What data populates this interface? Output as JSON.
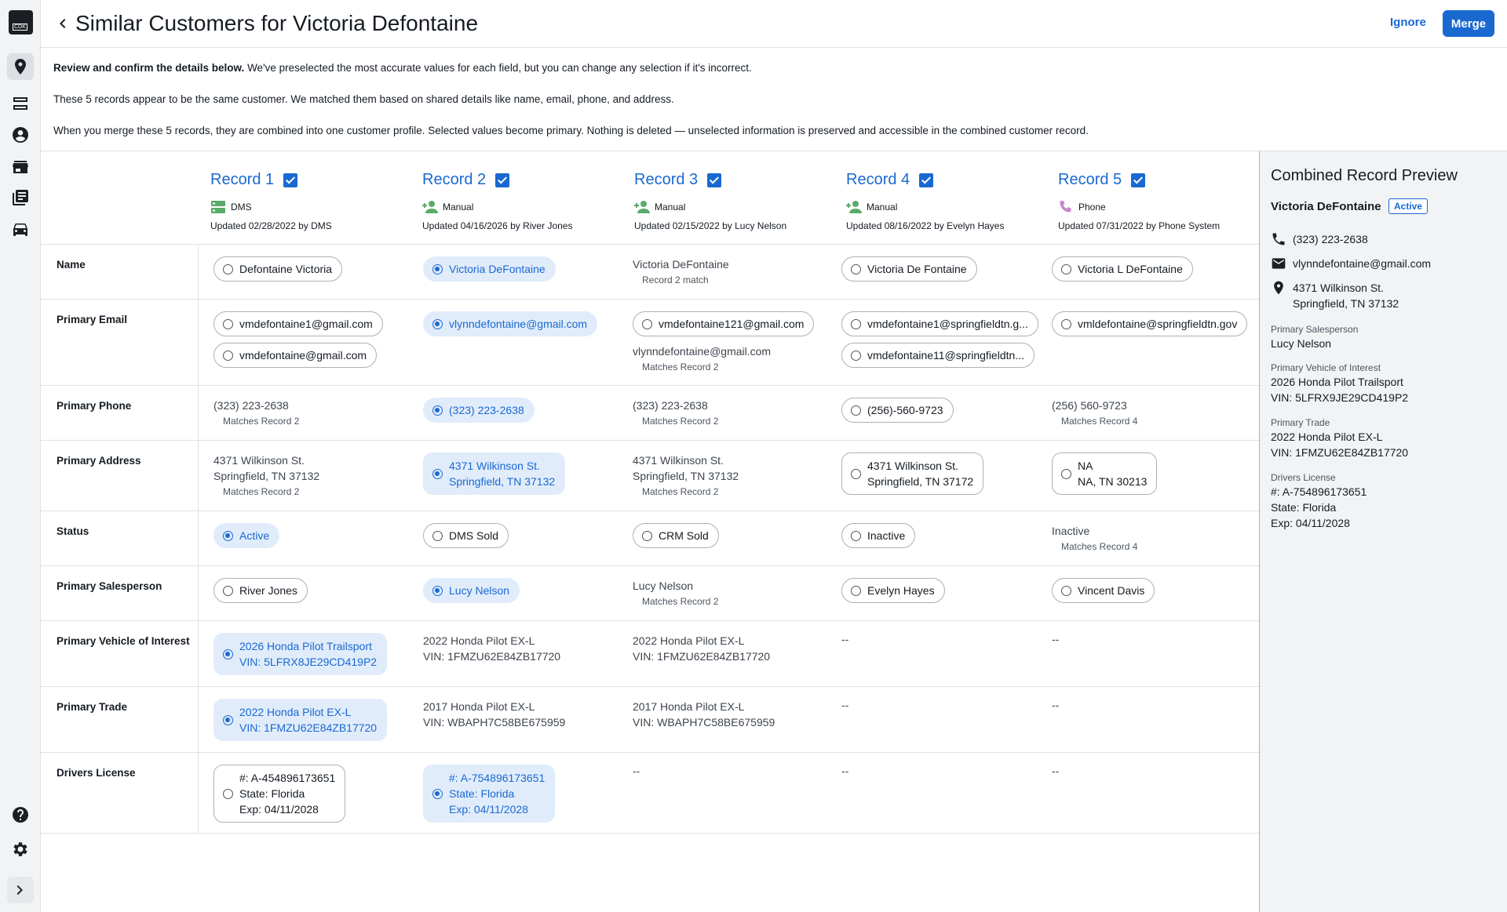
{
  "app": {
    "logo_text": "CDK"
  },
  "header": {
    "title": "Similar Customers for Victoria Defontaine",
    "ignore_label": "Ignore",
    "merge_label": "Merge"
  },
  "intro": {
    "line1_bold": "Review and confirm the details below.",
    "line1_rest": " We've preselected the most accurate values for each field, but you can change any selection if it's incorrect.",
    "line2": "These 5 records appear to be the same customer. We matched them based on shared details like name, email, phone, and address.",
    "line3": "When you merge these 5 records, they are combined into one customer profile. Selected values become primary. Nothing is deleted — unselected information is preserved and accessible in the combined customer record."
  },
  "records": [
    {
      "title": "Record 1",
      "source": "DMS",
      "updated": "Updated 02/28/2022 by DMS"
    },
    {
      "title": "Record 2",
      "source": "Manual",
      "updated": "Updated 04/16/2026 by River Jones"
    },
    {
      "title": "Record 3",
      "source": "Manual",
      "updated": "Updated 02/15/2022 by Lucy Nelson"
    },
    {
      "title": "Record 4",
      "source": "Manual",
      "updated": "Updated 08/16/2022 by Evelyn Hayes"
    },
    {
      "title": "Record 5",
      "source": "Phone",
      "updated": "Updated 07/31/2022 by Phone System"
    }
  ],
  "fields": {
    "name": {
      "label": "Name",
      "r1": "Defontaine Victoria",
      "r2": "Victoria DeFontaine",
      "r3": "Victoria DeFontaine",
      "r3_note": "Record 2 match",
      "r4": "Victoria De Fontaine",
      "r5": "Victoria L DeFontaine"
    },
    "email": {
      "label": "Primary Email",
      "r1a": "vmdefontaine1@gmail.com",
      "r1b": "vmdefontaine@gmail.com",
      "r2": "vlynndefontaine@gmail.com",
      "r3a": "vmdefontaine121@gmail.com",
      "r3b": "vlynndefontaine@gmail.com",
      "r3_note": "Matches Record 2",
      "r4a": "vmdefontaine1@springfieldtn.g...",
      "r4b": "vmdefontaine11@springfieldtn...",
      "r5": "vmldefontaine@springfieldtn.gov"
    },
    "phone": {
      "label": "Primary Phone",
      "r1": "(323) 223-2638",
      "r1_note": "Matches Record 2",
      "r2": "(323) 223-2638",
      "r3": "(323) 223-2638",
      "r3_note": "Matches Record 2",
      "r4": "(256)-560-9723",
      "r5": "(256) 560-9723",
      "r5_note": "Matches Record 4"
    },
    "address": {
      "label": "Primary Address",
      "r1_l1": "4371 Wilkinson St.",
      "r1_l2": "Springfield, TN 37132",
      "r1_note": "Matches Record 2",
      "r2_l1": "4371 Wilkinson St.",
      "r2_l2": "Springfield, TN 37132",
      "r3_l1": "4371 Wilkinson St.",
      "r3_l2": "Springfield, TN 37132",
      "r3_note": "Matches Record 2",
      "r4_l1": "4371 Wilkinson St.",
      "r4_l2": "Springfield, TN 37172",
      "r5_l1": "NA",
      "r5_l2": "NA, TN 30213"
    },
    "status": {
      "label": "Status",
      "r1": "Active",
      "r2": "DMS Sold",
      "r3": "CRM Sold",
      "r4": "Inactive",
      "r5": "Inactive",
      "r5_note": "Matches Record 4"
    },
    "salesperson": {
      "label": "Primary Salesperson",
      "r1": "River Jones",
      "r2": "Lucy Nelson",
      "r3": "Lucy Nelson",
      "r3_note": "Matches Record 2",
      "r4": "Evelyn Hayes",
      "r5": "Vincent Davis"
    },
    "vehicle": {
      "label": "Primary Vehicle of Interest",
      "r1_l1": "2026 Honda Pilot Trailsport",
      "r1_l2": "VIN: 5LFRX8JE29CD419P2",
      "r2_l1": "2022 Honda Pilot EX-L",
      "r2_l2": "VIN: 1FMZU62E84ZB17720",
      "r3_l1": "2022 Honda Pilot EX-L",
      "r3_l2": "VIN: 1FMZU62E84ZB17720",
      "r4": "--",
      "r5": "--"
    },
    "trade": {
      "label": "Primary Trade",
      "r1_l1": "2022 Honda Pilot EX-L",
      "r1_l2": "VIN: 1FMZU62E84ZB17720",
      "r2_l1": "2017 Honda Pilot EX-L",
      "r2_l2": "VIN: WBAPH7C58BE675959",
      "r3_l1": "2017 Honda Pilot EX-L",
      "r3_l2": "VIN: WBAPH7C58BE675959",
      "r4": "--",
      "r5": "--"
    },
    "license": {
      "label": "Drivers License",
      "r1_l1": "#: A-454896173651",
      "r1_l2": "State: Florida",
      "r1_l3": "Exp: 04/11/2028",
      "r2_l1": "#: A-754896173651",
      "r2_l2": "State: Florida",
      "r2_l3": "Exp: 04/11/2028",
      "r3": "--",
      "r4": "--",
      "r5": "--"
    }
  },
  "preview": {
    "title": "Combined Record Preview",
    "name": "Victoria DeFontaine",
    "badge": "Active",
    "phone": "(323) 223-2638",
    "email": "vlynndefontaine@gmail.com",
    "addr_l1": "4371 Wilkinson St.",
    "addr_l2": "Springfield, TN 37132",
    "salesperson_label": "Primary Salesperson",
    "salesperson": "Lucy Nelson",
    "vehicle_label": "Primary Vehicle of Interest",
    "vehicle_l1": "2026 Honda Pilot Trailsport",
    "vehicle_l2": "VIN: 5LFRX9JE29CD419P2",
    "trade_label": "Primary Trade",
    "trade_l1": "2022 Honda Pilot EX-L",
    "trade_l2": "VIN: 1FMZU62E84ZB17720",
    "license_label": "Drivers License",
    "license_l1": "#: A-754896173651",
    "license_l2": "State: Florida",
    "license_l3": "Exp: 04/11/2028"
  },
  "colors": {
    "accent": "#1969d1",
    "selected_bg": "#e1ecfb",
    "rail_bg": "#f2f3f4"
  }
}
